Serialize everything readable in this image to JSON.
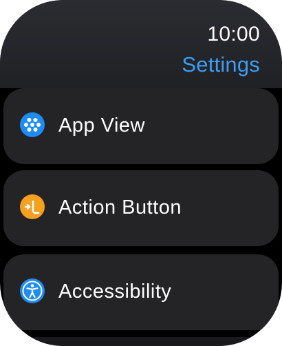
{
  "status_bar": {
    "time": "10:00"
  },
  "header": {
    "title": "Settings"
  },
  "settings_items": [
    {
      "label": "App View",
      "icon": "app-grid-icon",
      "icon_color": "#1f8cf3"
    },
    {
      "label": "Action Button",
      "icon": "action-button-icon",
      "icon_color": "#f6a020"
    },
    {
      "label": "Accessibility",
      "icon": "accessibility-icon",
      "icon_color": "#1f8cf3"
    }
  ],
  "colors": {
    "accent": "#3d9df3",
    "row_background": "#242426",
    "screen_background": "#000000"
  }
}
